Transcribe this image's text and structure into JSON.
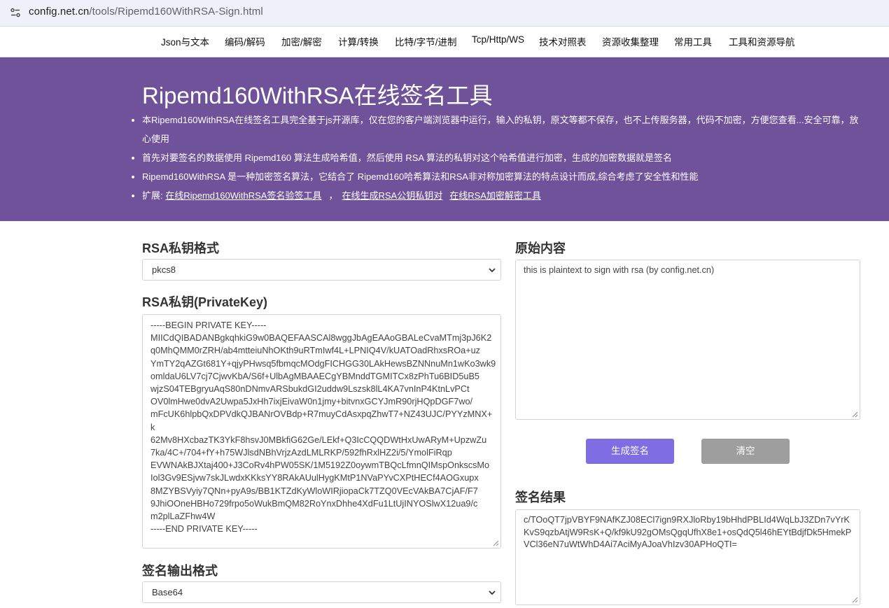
{
  "browser": {
    "url_host": "config.net.cn",
    "url_path": "/tools/Ripemd160WithRSA-Sign.html"
  },
  "nav": {
    "items": [
      "Json与文本",
      "编码/解码",
      "加密/解密",
      "计算/转换",
      "比特/字节/进制",
      "Tcp/Http/WS",
      "技术对照表",
      "资源收集整理",
      "常用工具",
      "工具和资源导航"
    ]
  },
  "hero": {
    "title": "Ripemd160WithRSA在线签名工具",
    "bullets": [
      "本Ripemd160WithRSA在线签名工具完全基于js开源库，仅在您的客户端浏览器中运行，输入的私钥，原文等都不保存，也不上传服务器，代码不加密，方便您查看...安全可靠，放心使用",
      "首先对要签名的数据使用 Ripemd160 算法生成哈希值，然后使用 RSA 算法的私钥对这个哈希值进行加密，生成的加密数据就是签名",
      "Ripemd160WithRSA 是一种加密签名算法，它结合了 Ripemd160哈希算法和RSA非对称加密算法的特点设计而成,综合考虑了安全性和性能"
    ],
    "ext_prefix": "扩展: ",
    "ext_links": [
      "在线Ripemd160WithRSA签名验签工具",
      "在线生成RSA公钥私钥对",
      "在线RSA加密解密工具"
    ]
  },
  "form": {
    "key_format_label": "RSA私钥格式",
    "key_format_value": "pkcs8",
    "private_key_label": "RSA私钥(PrivateKey)",
    "private_key_value": "-----BEGIN PRIVATE KEY-----\nMIICdQIBADANBgkqhkiG9w0BAQEFAASCAl8wggJbAgEAAoGBALeCvaMTmj3pJ6K2\nq0MhQMM0rZRH/ab4mtteiuNhOKth9uRTmIwf4L+LPNIQ4V/kUATOadRhxsROa+uz\nYmTY2qAZGt681Y+qjyPHwsq5fbmqcMOdgFICHGG30LAkHewsBZNNnuMn1wKo3wk9\nomldaU6LV7cj7CjwvKbA/S6f+UlbAgMBAAECgYBMnddTGMITCx8zPhTu6BID5uB5\nwjzS04TEBgryuAqS80nDNmvARSbukdGI2uddw9Lszsk8lL4KA7vnInP4KtnLvPCt\nOV0lmHwe0dvA2Uwpa5JxHh7ixjEivaW0n1jmy+bitvnxGCYJmR90rjHQpDGF7wo/\nmFcUK6hlpbQxDPVdkQJBANrOVBdp+R7muyCdAsxpqZhwT7+NZ43UJC/PYYzMNX+\nk\n62Mv8HXcbazTK3YkF8hsvJ0MBkfiG62Ge/LEkf+Q3IcCQQDWtHxUwARyM+UpzwZu\n7ka/4C+/704+fY+h75WJlsdNBhVrjzAzdLMLRKP/592fhRxlHZ2i/5/YmolFiRqp\nEVWNAkBJXtaj400+J3CoRv4hPW05SK/1M5192Z0oywmTBQcLfmnQIMspOnkscsMo\nIol3Gv9ESjvw7skJLwdxKKksYY8RAkAUulHygKMtP1NVaPYvCXPtHECf4AOGxupx\n8MZYBSVyiy7QNn+pyA9s/BB1KTZdKyWloWIRjiopaCk7TZQ0VEcVAkBA7CjAF/F7\n9JhiOOneHBHo729frpo5oWukBmQM82RoYnxDhhe4XdFu1LtUjINYOSlwX12ua9/c\nm2plLaZFhw4W\n-----END PRIVATE KEY-----",
    "output_format_label": "签名输出格式",
    "output_format_value": "Base64",
    "plaintext_label": "原始内容",
    "plaintext_value": "this is plaintext to sign with rsa (by config.net.cn)",
    "generate_button": "生成签名",
    "clear_button": "清空",
    "result_label": "签名结果",
    "result_value": "c/TOoQT7jpVBYF9NAfKZJ08ECl7ign9RXJloRby19bHhdPBLId4WqLbJ3ZDn7vYrKKvS9qzbAtjW9RsK+Q/kf9kU92gOMsQgqUfhX8e1+osQdQ5l46hEYtBdjfDk5HmekPVCl36eN7uWtWhD4Ai7AciMyAJoaVhIzv30APHoQTI="
  },
  "colors": {
    "hero_bg": "#70529a",
    "primary_button": "#7e6de3",
    "gray_button": "#9e9e9e"
  }
}
